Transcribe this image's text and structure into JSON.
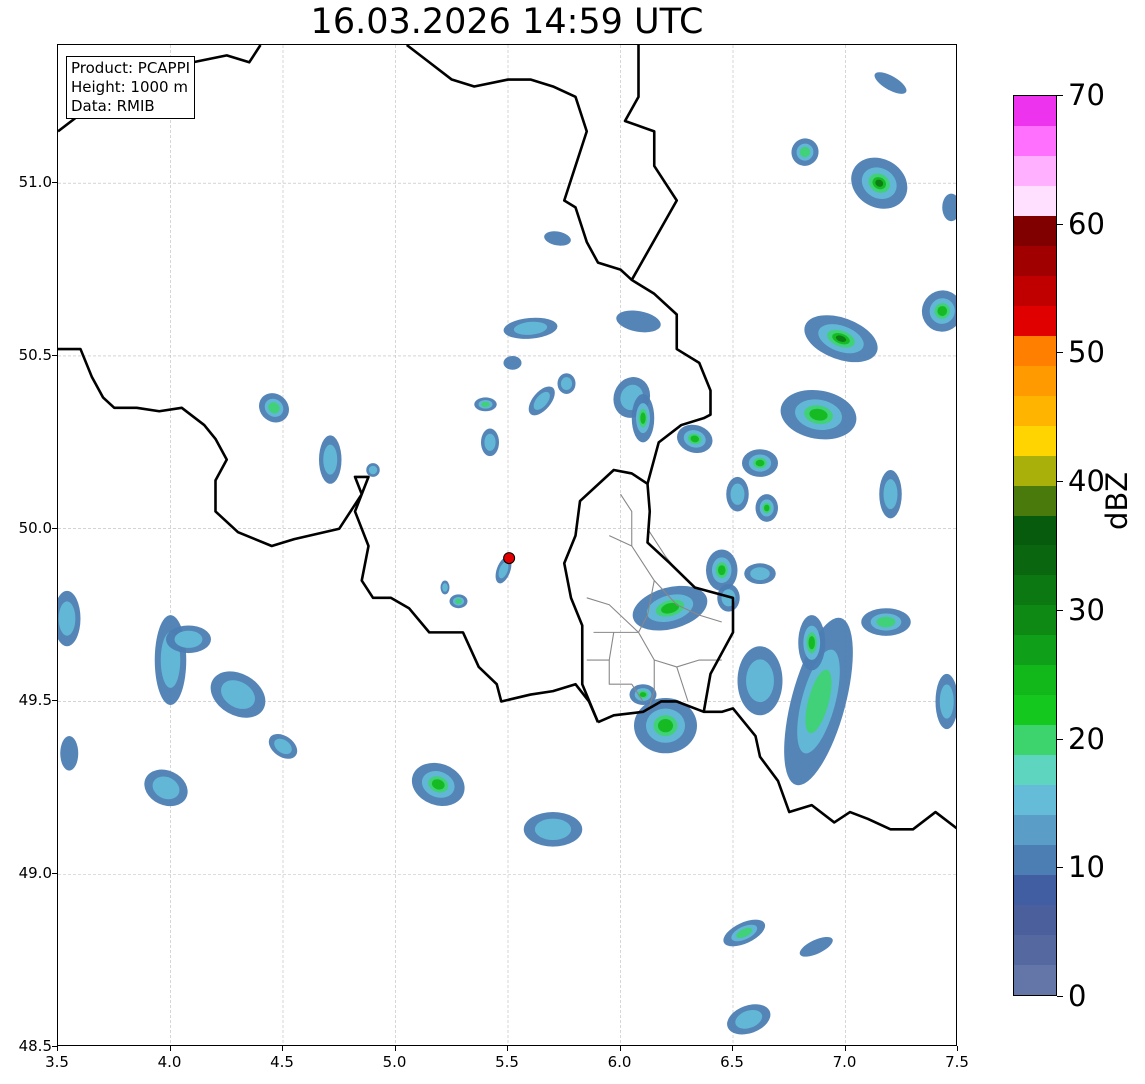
{
  "title": "16.03.2026 14:59 UTC",
  "info": {
    "product": "Product: PCAPPI",
    "height": "Height: 1000 m",
    "data": "Data: RMIB"
  },
  "x_axis": {
    "ticks": [
      "3.5",
      "4.0",
      "4.5",
      "5.0",
      "5.5",
      "6.0",
      "6.5",
      "7.0",
      "7.5"
    ],
    "range": [
      3.5,
      7.5
    ]
  },
  "y_axis": {
    "ticks": [
      "48.5",
      "49.0",
      "49.5",
      "50.0",
      "50.5",
      "51.0"
    ],
    "range": [
      48.5,
      51.4
    ]
  },
  "radar_site": {
    "lon": 5.505,
    "lat": 49.915,
    "color": "#e00000"
  },
  "colorbar": {
    "label": "dBZ",
    "range": [
      0,
      70
    ],
    "tick_labels": [
      "0",
      "10",
      "20",
      "30",
      "40",
      "50",
      "60",
      "70"
    ],
    "colors": [
      "#6475a8",
      "#5668a0",
      "#4a5f9c",
      "#425ea2",
      "#4c7db3",
      "#5a9dc6",
      "#65bcd9",
      "#5ed6bf",
      "#3dd46e",
      "#14c81e",
      "#12b81a",
      "#109f18",
      "#0e8a14",
      "#0c7812",
      "#0a6710",
      "#075b0c",
      "#4a7a0c",
      "#aab00a",
      "#ffd400",
      "#ffb400",
      "#ff9a00",
      "#ff7f00",
      "#e00000",
      "#c00000",
      "#a00000",
      "#800000",
      "#ffe0ff",
      "#ffb0ff",
      "#ff70ff",
      "#ee33ee"
    ]
  },
  "echoes": [
    {
      "lon": 4.0,
      "lat": 49.62,
      "rx": 0.07,
      "ry": 0.13,
      "rot": 0,
      "max": 1
    },
    {
      "lon": 4.08,
      "lat": 49.68,
      "rx": 0.1,
      "ry": 0.04,
      "rot": 0,
      "max": 1
    },
    {
      "lon": 4.3,
      "lat": 49.52,
      "rx": 0.13,
      "ry": 0.06,
      "rot": 30,
      "max": 1
    },
    {
      "lon": 4.5,
      "lat": 49.37,
      "rx": 0.07,
      "ry": 0.03,
      "rot": 35,
      "max": 1
    },
    {
      "lon": 3.98,
      "lat": 49.25,
      "rx": 0.1,
      "ry": 0.05,
      "rot": 25,
      "max": 1
    },
    {
      "lon": 3.54,
      "lat": 49.74,
      "rx": 0.06,
      "ry": 0.08,
      "rot": 0,
      "max": 1
    },
    {
      "lon": 3.55,
      "lat": 49.35,
      "rx": 0.04,
      "ry": 0.05,
      "rot": 0,
      "max": 0
    },
    {
      "lon": 4.46,
      "lat": 50.35,
      "rx": 0.07,
      "ry": 0.04,
      "rot": 40,
      "max": 2
    },
    {
      "lon": 4.71,
      "lat": 50.2,
      "rx": 0.05,
      "ry": 0.07,
      "rot": 0,
      "max": 1
    },
    {
      "lon": 5.19,
      "lat": 49.26,
      "rx": 0.12,
      "ry": 0.06,
      "rot": 20,
      "max": 3
    },
    {
      "lon": 5.7,
      "lat": 49.13,
      "rx": 0.13,
      "ry": 0.05,
      "rot": 0,
      "max": 1
    },
    {
      "lon": 5.28,
      "lat": 49.79,
      "rx": 0.04,
      "ry": 0.02,
      "rot": 0,
      "max": 2
    },
    {
      "lon": 5.4,
      "lat": 50.36,
      "rx": 0.05,
      "ry": 0.02,
      "rot": 0,
      "max": 2
    },
    {
      "lon": 5.42,
      "lat": 50.25,
      "rx": 0.04,
      "ry": 0.04,
      "rot": 0,
      "max": 1
    },
    {
      "lon": 5.6,
      "lat": 50.58,
      "rx": 0.12,
      "ry": 0.03,
      "rot": -5,
      "max": 1
    },
    {
      "lon": 5.52,
      "lat": 50.48,
      "rx": 0.04,
      "ry": 0.02,
      "rot": 0,
      "max": 0
    },
    {
      "lon": 5.65,
      "lat": 50.37,
      "rx": 0.04,
      "ry": 0.05,
      "rot": 40,
      "max": 1
    },
    {
      "lon": 5.76,
      "lat": 50.42,
      "rx": 0.04,
      "ry": 0.03,
      "rot": 0,
      "max": 1
    },
    {
      "lon": 5.72,
      "lat": 50.84,
      "rx": 0.06,
      "ry": 0.02,
      "rot": 10,
      "max": 0
    },
    {
      "lon": 6.08,
      "lat": 50.6,
      "rx": 0.1,
      "ry": 0.03,
      "rot": 10,
      "max": 0
    },
    {
      "lon": 6.05,
      "lat": 50.38,
      "rx": 0.08,
      "ry": 0.06,
      "rot": 20,
      "max": 1
    },
    {
      "lon": 6.1,
      "lat": 50.32,
      "rx": 0.05,
      "ry": 0.07,
      "rot": 0,
      "max": 3
    },
    {
      "lon": 6.33,
      "lat": 50.26,
      "rx": 0.08,
      "ry": 0.04,
      "rot": 15,
      "max": 3
    },
    {
      "lon": 6.62,
      "lat": 50.19,
      "rx": 0.08,
      "ry": 0.04,
      "rot": 0,
      "max": 3
    },
    {
      "lon": 6.52,
      "lat": 50.1,
      "rx": 0.05,
      "ry": 0.05,
      "rot": 0,
      "max": 1
    },
    {
      "lon": 6.65,
      "lat": 50.06,
      "rx": 0.05,
      "ry": 0.04,
      "rot": 0,
      "max": 3
    },
    {
      "lon": 6.22,
      "lat": 49.77,
      "rx": 0.17,
      "ry": 0.06,
      "rot": -15,
      "max": 3
    },
    {
      "lon": 6.45,
      "lat": 49.88,
      "rx": 0.07,
      "ry": 0.06,
      "rot": 0,
      "max": 3
    },
    {
      "lon": 6.62,
      "lat": 49.87,
      "rx": 0.07,
      "ry": 0.03,
      "rot": 0,
      "max": 1
    },
    {
      "lon": 6.48,
      "lat": 49.8,
      "rx": 0.05,
      "ry": 0.04,
      "rot": 0,
      "max": 1
    },
    {
      "lon": 6.2,
      "lat": 49.43,
      "rx": 0.14,
      "ry": 0.08,
      "rot": 0,
      "max": 3
    },
    {
      "lon": 6.1,
      "lat": 49.52,
      "rx": 0.06,
      "ry": 0.03,
      "rot": 0,
      "max": 3
    },
    {
      "lon": 6.62,
      "lat": 49.56,
      "rx": 0.1,
      "ry": 0.1,
      "rot": 0,
      "max": 1
    },
    {
      "lon": 6.88,
      "lat": 49.5,
      "rx": 0.12,
      "ry": 0.25,
      "rot": 15,
      "max": 2
    },
    {
      "lon": 6.85,
      "lat": 49.67,
      "rx": 0.06,
      "ry": 0.08,
      "rot": 0,
      "max": 3
    },
    {
      "lon": 7.18,
      "lat": 49.73,
      "rx": 0.11,
      "ry": 0.04,
      "rot": 0,
      "max": 2
    },
    {
      "lon": 7.45,
      "lat": 49.5,
      "rx": 0.05,
      "ry": 0.08,
      "rot": 0,
      "max": 1
    },
    {
      "lon": 6.88,
      "lat": 50.33,
      "rx": 0.17,
      "ry": 0.07,
      "rot": 10,
      "max": 3
    },
    {
      "lon": 6.98,
      "lat": 50.55,
      "rx": 0.17,
      "ry": 0.06,
      "rot": 20,
      "max": 4
    },
    {
      "lon": 7.15,
      "lat": 51.0,
      "rx": 0.13,
      "ry": 0.07,
      "rot": 30,
      "max": 4
    },
    {
      "lon": 6.82,
      "lat": 51.09,
      "rx": 0.06,
      "ry": 0.04,
      "rot": 30,
      "max": 2
    },
    {
      "lon": 7.2,
      "lat": 50.1,
      "rx": 0.05,
      "ry": 0.07,
      "rot": 0,
      "max": 1
    },
    {
      "lon": 7.43,
      "lat": 50.63,
      "rx": 0.09,
      "ry": 0.06,
      "rot": 25,
      "max": 3
    },
    {
      "lon": 7.47,
      "lat": 50.93,
      "rx": 0.04,
      "ry": 0.04,
      "rot": 0,
      "max": 0
    },
    {
      "lon": 7.2,
      "lat": 51.29,
      "rx": 0.08,
      "ry": 0.02,
      "rot": 30,
      "max": 0
    },
    {
      "lon": 6.55,
      "lat": 48.83,
      "rx": 0.1,
      "ry": 0.03,
      "rot": -25,
      "max": 2
    },
    {
      "lon": 6.87,
      "lat": 48.79,
      "rx": 0.08,
      "ry": 0.02,
      "rot": -25,
      "max": 0
    },
    {
      "lon": 6.57,
      "lat": 48.58,
      "rx": 0.1,
      "ry": 0.04,
      "rot": -20,
      "max": 1
    },
    {
      "lon": 5.48,
      "lat": 49.88,
      "rx": 0.03,
      "ry": 0.04,
      "rot": 20,
      "max": 1
    },
    {
      "lon": 5.22,
      "lat": 49.83,
      "rx": 0.02,
      "ry": 0.02,
      "rot": 0,
      "max": 1
    },
    {
      "lon": 4.9,
      "lat": 50.17,
      "rx": 0.03,
      "ry": 0.02,
      "rot": 0,
      "max": 1
    }
  ],
  "borders": [
    [
      [
        3.5,
        50.52
      ],
      [
        3.6,
        50.52
      ],
      [
        3.65,
        50.44
      ],
      [
        3.7,
        50.38
      ],
      [
        3.75,
        50.35
      ],
      [
        3.85,
        50.35
      ],
      [
        3.95,
        50.34
      ],
      [
        4.05,
        50.35
      ],
      [
        4.15,
        50.3
      ],
      [
        4.2,
        50.26
      ],
      [
        4.25,
        50.2
      ],
      [
        4.2,
        50.14
      ],
      [
        4.2,
        50.05
      ],
      [
        4.3,
        49.99
      ],
      [
        4.45,
        49.95
      ],
      [
        4.55,
        49.97
      ],
      [
        4.75,
        50.0
      ],
      [
        4.85,
        50.1
      ],
      [
        4.82,
        50.15
      ],
      [
        4.88,
        50.15
      ],
      [
        4.82,
        50.05
      ],
      [
        4.88,
        49.95
      ],
      [
        4.85,
        49.85
      ],
      [
        4.9,
        49.8
      ],
      [
        4.98,
        49.8
      ],
      [
        5.06,
        49.77
      ],
      [
        5.15,
        49.7
      ],
      [
        5.3,
        49.7
      ],
      [
        5.37,
        49.6
      ],
      [
        5.45,
        49.55
      ],
      [
        5.47,
        49.5
      ],
      [
        5.6,
        49.52
      ],
      [
        5.7,
        49.53
      ],
      [
        5.8,
        49.55
      ],
      [
        5.86,
        49.5
      ],
      [
        5.9,
        49.44
      ]
    ],
    [
      [
        5.9,
        49.44
      ],
      [
        5.97,
        49.46
      ],
      [
        6.1,
        49.47
      ],
      [
        6.18,
        49.5
      ],
      [
        6.25,
        49.5
      ],
      [
        6.37,
        49.47
      ],
      [
        6.45,
        49.47
      ],
      [
        6.5,
        49.48
      ],
      [
        6.6,
        49.4
      ],
      [
        6.62,
        49.34
      ],
      [
        6.7,
        49.27
      ],
      [
        6.75,
        49.18
      ],
      [
        6.85,
        49.2
      ],
      [
        6.95,
        49.15
      ],
      [
        7.02,
        49.18
      ],
      [
        7.1,
        49.16
      ],
      [
        7.2,
        49.13
      ],
      [
        7.3,
        49.13
      ],
      [
        7.4,
        49.18
      ],
      [
        7.5,
        49.13
      ]
    ],
    [
      [
        5.9,
        49.44
      ],
      [
        5.83,
        49.55
      ],
      [
        5.83,
        49.72
      ],
      [
        5.78,
        49.8
      ],
      [
        5.75,
        49.9
      ],
      [
        5.8,
        49.98
      ],
      [
        5.82,
        50.08
      ],
      [
        5.97,
        50.17
      ],
      [
        6.05,
        50.16
      ],
      [
        6.12,
        50.13
      ],
      [
        6.13,
        50.05
      ],
      [
        6.12,
        49.96
      ],
      [
        6.22,
        49.9
      ],
      [
        6.33,
        49.83
      ],
      [
        6.5,
        49.8
      ],
      [
        6.5,
        49.7
      ],
      [
        6.4,
        49.58
      ],
      [
        6.37,
        49.47
      ]
    ],
    [
      [
        6.12,
        50.13
      ],
      [
        6.17,
        50.25
      ],
      [
        6.27,
        50.3
      ],
      [
        6.37,
        50.32
      ],
      [
        6.4,
        50.33
      ],
      [
        6.4,
        50.4
      ],
      [
        6.35,
        50.48
      ],
      [
        6.25,
        50.52
      ],
      [
        6.25,
        50.62
      ],
      [
        6.15,
        50.68
      ],
      [
        6.05,
        50.72
      ],
      [
        6.0,
        50.75
      ],
      [
        5.9,
        50.77
      ],
      [
        5.85,
        50.83
      ],
      [
        5.8,
        50.93
      ],
      [
        5.75,
        50.95
      ],
      [
        5.8,
        51.05
      ],
      [
        5.85,
        51.15
      ],
      [
        5.8,
        51.25
      ],
      [
        5.7,
        51.28
      ],
      [
        5.6,
        51.3
      ],
      [
        5.5,
        51.3
      ],
      [
        5.35,
        51.28
      ],
      [
        5.25,
        51.3
      ],
      [
        5.15,
        51.35
      ],
      [
        5.05,
        51.4
      ]
    ],
    [
      [
        4.4,
        51.4
      ],
      [
        4.35,
        51.35
      ],
      [
        4.25,
        51.37
      ],
      [
        4.1,
        51.35
      ],
      [
        3.98,
        51.32
      ],
      [
        3.85,
        51.28
      ],
      [
        3.7,
        51.25
      ],
      [
        3.6,
        51.2
      ],
      [
        3.5,
        51.15
      ]
    ],
    [
      [
        6.05,
        50.72
      ],
      [
        6.25,
        50.95
      ],
      [
        6.15,
        51.05
      ],
      [
        6.15,
        51.15
      ],
      [
        6.02,
        51.18
      ],
      [
        6.08,
        51.25
      ],
      [
        6.08,
        51.4
      ]
    ]
  ],
  "lux_cantons": [
    [
      [
        5.95,
        49.98
      ],
      [
        6.05,
        49.95
      ],
      [
        6.15,
        49.85
      ],
      [
        6.12,
        49.75
      ],
      [
        6.08,
        49.7
      ],
      [
        5.97,
        49.7
      ],
      [
        5.88,
        49.7
      ]
    ],
    [
      [
        6.15,
        49.85
      ],
      [
        6.25,
        49.78
      ],
      [
        6.35,
        49.75
      ],
      [
        6.45,
        49.73
      ]
    ],
    [
      [
        6.05,
        49.95
      ],
      [
        6.05,
        50.05
      ],
      [
        6.0,
        50.1
      ]
    ],
    [
      [
        6.08,
        49.7
      ],
      [
        6.15,
        49.62
      ],
      [
        6.25,
        49.6
      ],
      [
        6.35,
        49.62
      ],
      [
        6.45,
        49.62
      ]
    ],
    [
      [
        5.97,
        49.7
      ],
      [
        5.95,
        49.62
      ],
      [
        5.85,
        49.62
      ]
    ],
    [
      [
        6.15,
        49.62
      ],
      [
        6.15,
        49.53
      ],
      [
        6.12,
        49.47
      ]
    ],
    [
      [
        5.95,
        49.62
      ],
      [
        5.95,
        49.55
      ],
      [
        6.05,
        49.55
      ],
      [
        6.1,
        49.5
      ]
    ],
    [
      [
        6.25,
        49.6
      ],
      [
        6.3,
        49.5
      ]
    ],
    [
      [
        5.85,
        49.8
      ],
      [
        5.95,
        49.78
      ],
      [
        6.08,
        49.7
      ]
    ],
    [
      [
        6.12,
        50.0
      ],
      [
        6.2,
        49.92
      ],
      [
        6.25,
        49.88
      ]
    ]
  ]
}
